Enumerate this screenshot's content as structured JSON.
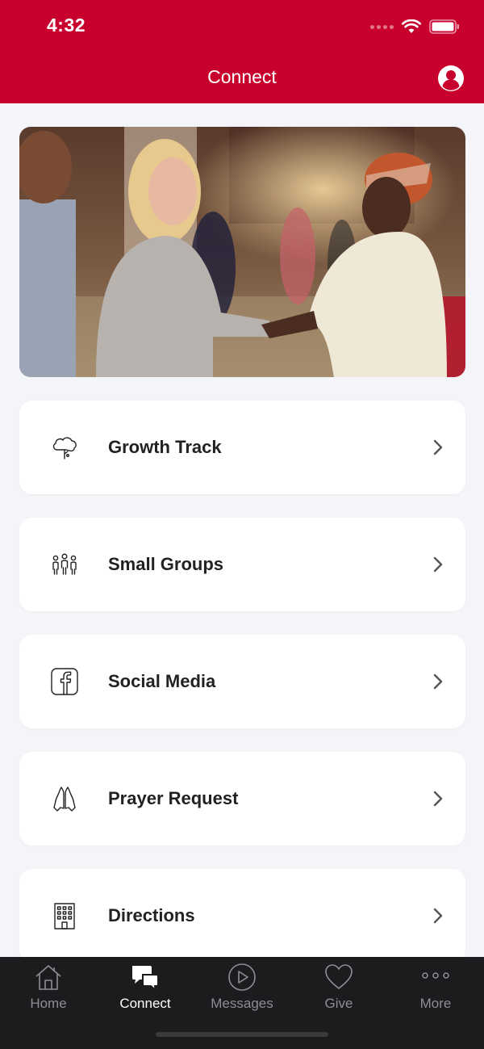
{
  "status_bar": {
    "time": "4:32"
  },
  "header": {
    "title": "Connect",
    "profile_icon": "profile-icon"
  },
  "hero": {
    "image": "people-shaking-hands-photo"
  },
  "menu_items": [
    {
      "label": "Growth Track",
      "icon": "tree-icon"
    },
    {
      "label": "Small Groups",
      "icon": "people-group-icon"
    },
    {
      "label": "Social Media",
      "icon": "facebook-icon"
    },
    {
      "label": "Prayer Request",
      "icon": "praying-hands-icon"
    },
    {
      "label": "Directions",
      "icon": "building-icon"
    }
  ],
  "tab_bar": {
    "active": "Connect",
    "tabs": [
      {
        "label": "Home",
        "icon": "home-icon"
      },
      {
        "label": "Connect",
        "icon": "chat-bubbles-icon"
      },
      {
        "label": "Messages",
        "icon": "play-icon"
      },
      {
        "label": "Give",
        "icon": "heart-icon"
      },
      {
        "label": "More",
        "icon": "more-dots-icon"
      }
    ]
  },
  "colors": {
    "brand": "#c8002d",
    "background": "#f4f5f9",
    "tabbar": "#1c1c1e"
  }
}
